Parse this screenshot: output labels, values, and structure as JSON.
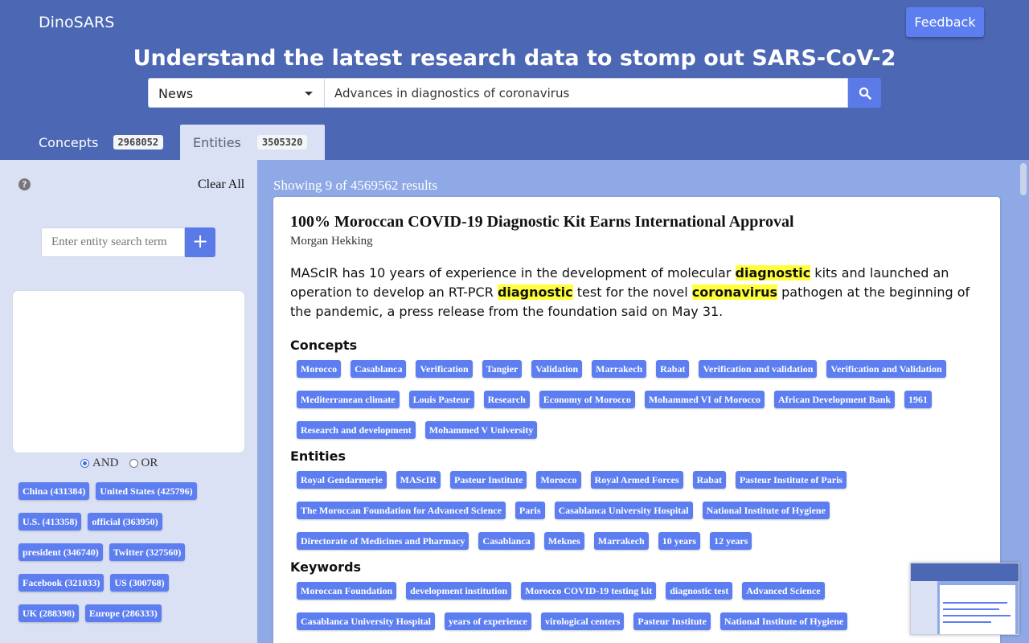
{
  "header": {
    "brand": "DinoSARS",
    "feedback_label": "Feedback",
    "headline": "Understand the latest research data to stomp out SARS-CoV-2",
    "search": {
      "category_selected": "News",
      "query": "Advances in diagnostics of coronavirus",
      "search_icon": "search-icon"
    }
  },
  "tabs": [
    {
      "label": "Concepts",
      "count": "2968052",
      "active": false
    },
    {
      "label": "Entities",
      "count": "3505320",
      "active": true
    }
  ],
  "sidebar": {
    "help_icon": "?",
    "clear_all": "Clear All",
    "entity_search_placeholder": "Enter entity search term",
    "add_label": "+",
    "logic": {
      "and": "AND",
      "or": "OR",
      "selected": "AND"
    },
    "facets": [
      [
        "China (431384)",
        "United States (425796)"
      ],
      [
        "U.S. (413358)",
        "official (363950)"
      ],
      [
        "president (346740)",
        "Twitter (327560)"
      ],
      [
        "Facebook (321033)",
        "US (300768)"
      ],
      [
        "UK (288398)",
        "Europe (286333)"
      ]
    ]
  },
  "results": {
    "showing": "Showing 9 of 4569562 results",
    "card": {
      "title": "100% Moroccan COVID-19 Diagnostic Kit Earns International Approval",
      "author": "Morgan Hekking",
      "snippet_parts": [
        {
          "text": "MAScIR has 10 years of experience in the development of molecular ",
          "hl": false
        },
        {
          "text": "diagnostic",
          "hl": true
        },
        {
          "text": " kits and launched an operation to develop an RT-PCR ",
          "hl": false
        },
        {
          "text": "diagnostic",
          "hl": true
        },
        {
          "text": " test for the novel ",
          "hl": false
        },
        {
          "text": "coronavirus",
          "hl": true
        },
        {
          "text": " pathogen at the beginning of the pandemic, a press release from the foundation said on May 31.",
          "hl": false
        }
      ],
      "concepts_heading": "Concepts",
      "concepts": [
        [
          "Morocco",
          "Casablanca",
          "Verification",
          "Tangier",
          "Validation",
          "Marrakech",
          "Rabat",
          "Verification and validation",
          "Verification and Validation"
        ],
        [
          "Mediterranean climate",
          "Louis Pasteur",
          "Research",
          "Economy of Morocco",
          "Mohammed VI of Morocco",
          "African Development Bank",
          "1961"
        ],
        [
          "Research and development",
          "Mohammed V University"
        ]
      ],
      "entities_heading": "Entities",
      "entities": [
        [
          "Royal Gendarmerie",
          "MAScIR",
          "Pasteur Institute",
          "Morocco",
          "Royal Armed Forces",
          "Rabat",
          "Pasteur Institute of Paris"
        ],
        [
          "The Moroccan Foundation for Advanced Science",
          "Paris",
          "Casablanca University Hospital",
          "National Institute of Hygiene"
        ],
        [
          "Directorate of Medicines and Pharmacy",
          "Casablanca",
          "Meknes",
          "Marrakech",
          "10 years",
          "12 years"
        ]
      ],
      "keywords_heading": "Keywords",
      "keywords": [
        [
          "Moroccan Foundation",
          "development institution",
          "Morocco COVID-19 testing kit",
          "diagnostic test",
          "Advanced Science"
        ],
        [
          "Casablanca University Hospital",
          "years of experience",
          "virological centers",
          "Pasteur Institute",
          "National Institute of Hygiene"
        ]
      ]
    }
  }
}
